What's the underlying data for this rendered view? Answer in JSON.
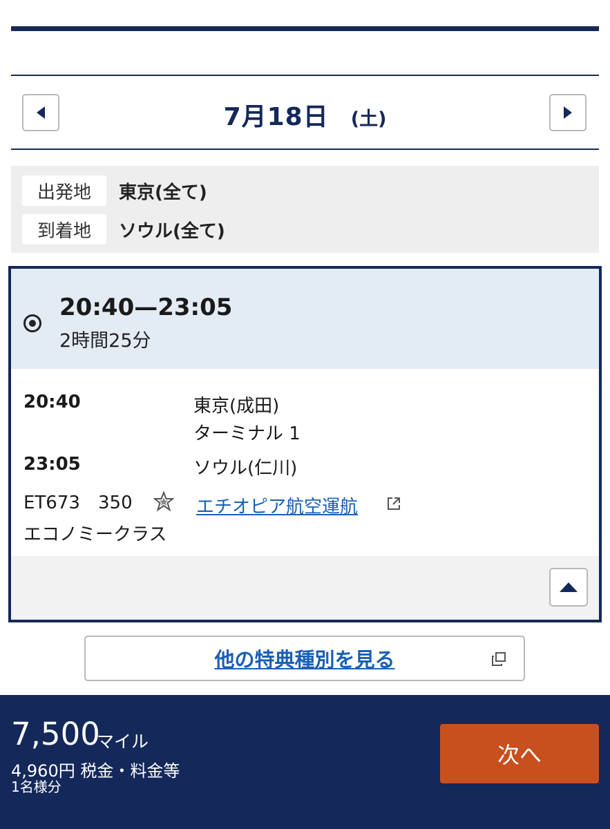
{
  "date_nav": {
    "date": "7月18日",
    "day_of_week": "(土)",
    "prev_icon": "chevron-left-icon",
    "next_icon": "chevron-right-icon"
  },
  "route": {
    "origin_label": "出発地",
    "origin_value": "東京(全て)",
    "destination_label": "到着地",
    "destination_value": "ソウル(全て)"
  },
  "flight": {
    "time_range": "20:40—23:05",
    "duration": "2時間25分",
    "departure_time": "20:40",
    "departure_airport": "東京(成田)",
    "departure_terminal": "ターミナル 1",
    "arrival_time": "23:05",
    "arrival_airport": "ソウル(仁川)",
    "flight_number": "ET673",
    "aircraft": "350",
    "alliance_icon": "star-alliance-icon",
    "operator_link": "エチオピア航空運航",
    "cabin": "エコノミークラス",
    "collapse_icon": "caret-up-icon"
  },
  "other_awards_button": "他の特典種別を見る",
  "footer": {
    "miles_value": "7,500",
    "miles_unit": "マイル",
    "tax_text": "4,960円 税金・料金等",
    "passengers": "1名様分",
    "next_button": "次へ"
  },
  "colors": {
    "navy": "#14285a",
    "link": "#1a5fb4",
    "next_button": "#c8501f",
    "card_header": "#e3ebf5"
  }
}
